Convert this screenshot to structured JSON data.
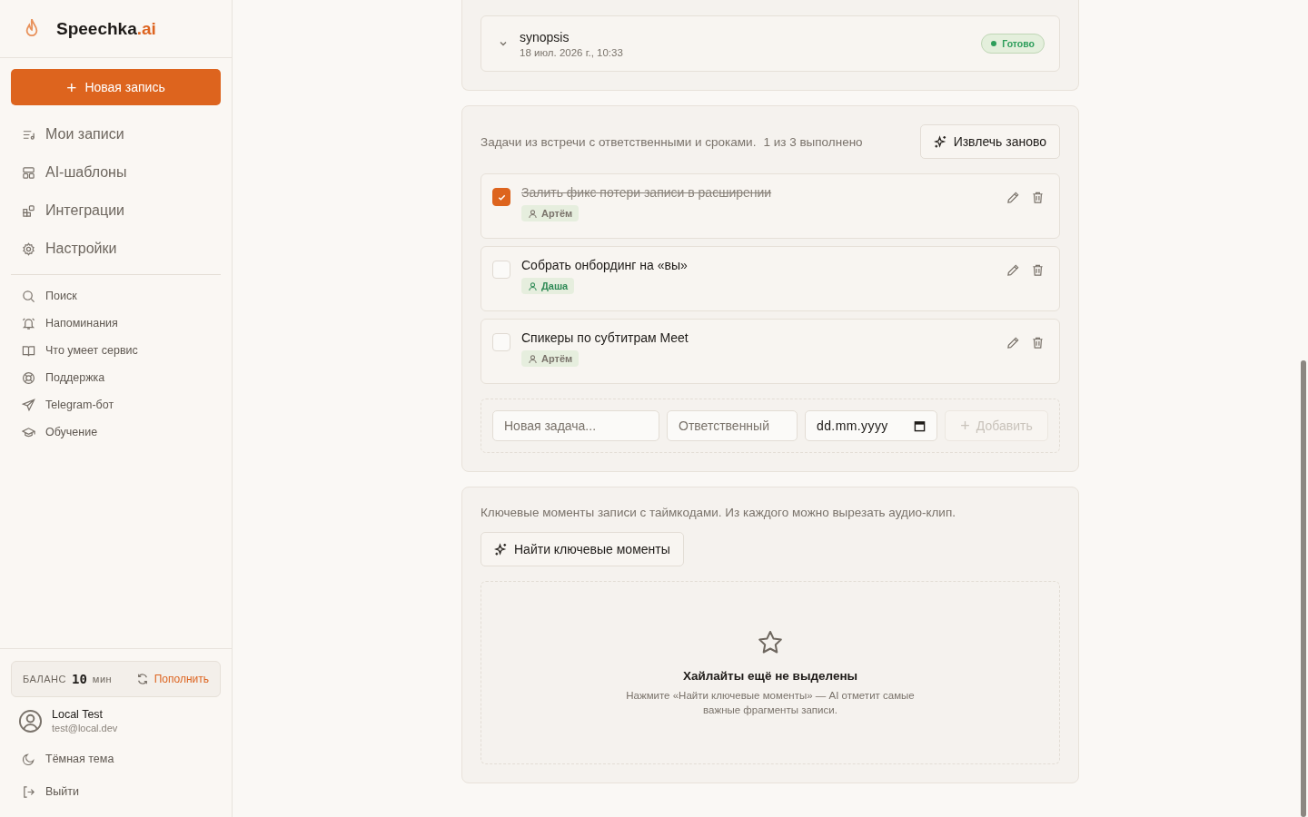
{
  "sidebar": {
    "logo": {
      "name": "Speechka",
      "suffix": ".ai"
    },
    "new_button": {
      "icon": "+",
      "label": "Новая запись"
    },
    "nav": [
      "Мои записи",
      "AI-шаблоны",
      "Интеграции",
      "Настройки"
    ],
    "links": [
      "Поиск",
      "Напоминания",
      "Что умеет сервис",
      "Поддержка",
      "Telegram-бот",
      "Обучение"
    ],
    "balance": {
      "label": "БАЛАНС",
      "value": "10",
      "unit": "мин",
      "action": "Пополнить"
    },
    "user": {
      "name": "Local Test",
      "email": "test@local.dev"
    },
    "theme_toggle": "Тёмная тема",
    "logout": "Выйти"
  },
  "reports": [
    {
      "title": "synopsis",
      "date": "18 июл. 2026 г., 10:33",
      "status": "Готово",
      "color": "#2e9e5b"
    }
  ],
  "tasks": {
    "description": "Задачи из встречи с ответственными и сроками.",
    "done_summary": "1 из 3 выполнено",
    "action": "Извлечь заново",
    "items": [
      {
        "text": "Залить фикс потери записи в расширении",
        "checked": true,
        "assignee": "Артём",
        "color": "#7a736b"
      },
      {
        "text": "Собрать онбординг на «вы»",
        "checked": false,
        "assignee": "Даша",
        "color": "#2e8a55"
      },
      {
        "text": "Спикеры по субтитрам Meet",
        "checked": false,
        "assignee": "Артём",
        "color": "#7a736b"
      }
    ],
    "form": {
      "task_placeholder": "Новая задача...",
      "assignee_placeholder": "Ответственный",
      "date_placeholder": "dd.mm.yyyy",
      "add_label": "Добавить",
      "disabled": true
    }
  },
  "highlights": {
    "description": "Ключевые моменты записи с таймкодами. Из каждого можно вырезать аудио-клип.",
    "action": "Найти ключевые моменты",
    "empty_title": "Хайлайты ещё не выделены",
    "empty_text": "Нажмите «Найти ключевые моменты» — AI отметит самые важные фрагменты записи."
  }
}
